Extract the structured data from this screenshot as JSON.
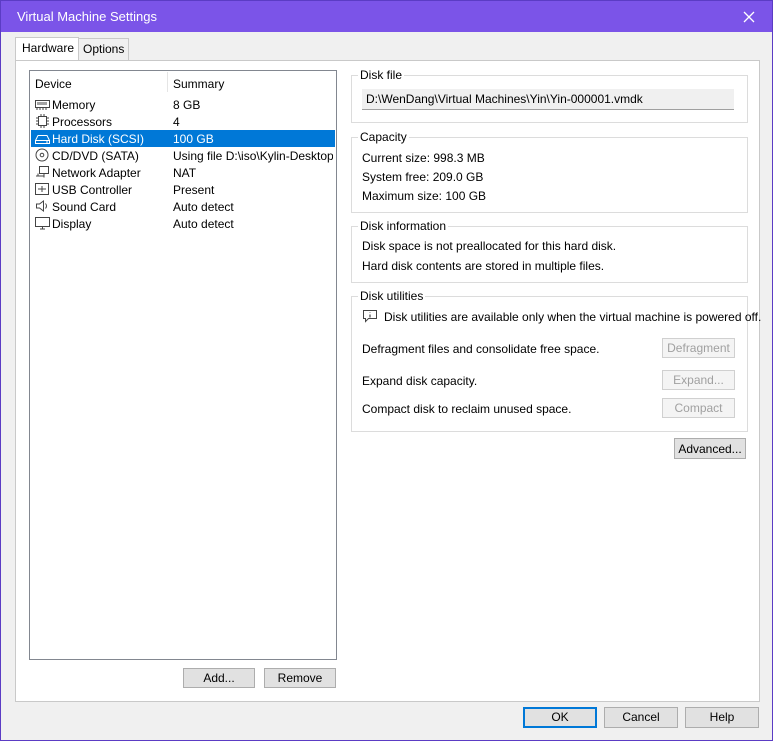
{
  "window": {
    "title": "Virtual Machine Settings"
  },
  "tabs": [
    {
      "label": "Hardware",
      "active": true
    },
    {
      "label": "Options",
      "active": false
    }
  ],
  "device_list": {
    "headers": {
      "device": "Device",
      "summary": "Summary"
    },
    "rows": [
      {
        "icon": "memory-icon",
        "device": "Memory",
        "summary": "8 GB",
        "selected": false
      },
      {
        "icon": "processor-icon",
        "device": "Processors",
        "summary": "4",
        "selected": false
      },
      {
        "icon": "hard-disk-icon",
        "device": "Hard Disk (SCSI)",
        "summary": "100 GB",
        "selected": true
      },
      {
        "icon": "cd-dvd-icon",
        "device": "CD/DVD (SATA)",
        "summary": "Using file D:\\iso\\Kylin-Desktop…",
        "selected": false
      },
      {
        "icon": "network-adapter-icon",
        "device": "Network Adapter",
        "summary": "NAT",
        "selected": false
      },
      {
        "icon": "usb-controller-icon",
        "device": "USB Controller",
        "summary": "Present",
        "selected": false
      },
      {
        "icon": "sound-card-icon",
        "device": "Sound Card",
        "summary": "Auto detect",
        "selected": false
      },
      {
        "icon": "display-icon",
        "device": "Display",
        "summary": "Auto detect",
        "selected": false
      }
    ],
    "add_label": "Add...",
    "remove_label": "Remove"
  },
  "disk_file": {
    "title": "Disk file",
    "path": "D:\\WenDang\\Virtual Machines\\Yin\\Yin-000001.vmdk"
  },
  "capacity": {
    "title": "Capacity",
    "current_size": "Current size:  998.3 MB",
    "system_free": "System free:  209.0 GB",
    "maximum_size": "Maximum size:  100 GB"
  },
  "disk_information": {
    "title": "Disk information",
    "line1": "Disk space is not preallocated for this hard disk.",
    "line2": "Hard disk contents are stored in multiple files."
  },
  "disk_utilities": {
    "title": "Disk utilities",
    "notice": "Disk utilities are available only when the virtual machine is powered off.",
    "defragment_text": "Defragment files and consolidate free space.",
    "defragment_label": "Defragment",
    "expand_text": "Expand disk capacity.",
    "expand_label": "Expand...",
    "compact_text": "Compact disk to reclaim unused space.",
    "compact_label": "Compact"
  },
  "advanced_label": "Advanced...",
  "footer": {
    "ok_label": "OK",
    "cancel_label": "Cancel",
    "help_label": "Help"
  },
  "colors": {
    "title_bar": "#7b54e8",
    "selection": "#0078d7"
  }
}
